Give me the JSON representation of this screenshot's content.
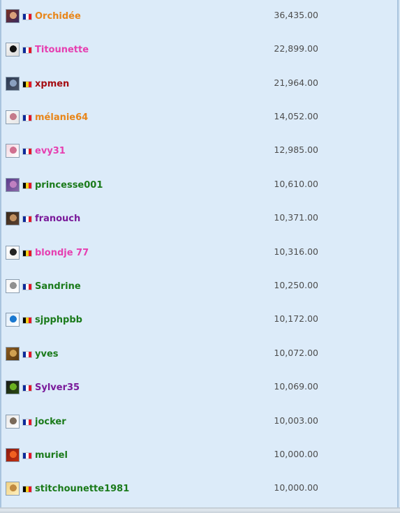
{
  "flag_colors": {
    "fr": [
      "#0d2a9a",
      "#ffffff",
      "#e3172a"
    ],
    "be": [
      "#000000",
      "#f5d21b",
      "#e3172a"
    ]
  },
  "leaderboard": [
    {
      "username": "Orchidée",
      "points": "36,435.00",
      "flag": "fr",
      "color": "#e8861a",
      "avatar_icon": "avatar-anime-girl-icon",
      "avatar_colors": [
        "#7a3020",
        "#d9a07a",
        "#3a2a60"
      ]
    },
    {
      "username": "Titounette",
      "points": "22,899.00",
      "flag": "fr",
      "color": "#e63fb0",
      "avatar_icon": "avatar-black-cat-icon",
      "avatar_colors": [
        "#f4f4f4",
        "#111111",
        "#dcdcdc"
      ]
    },
    {
      "username": "xpmen",
      "points": "21,964.00",
      "flag": "be",
      "color": "#a50d12",
      "avatar_icon": "avatar-landscape-icon",
      "avatar_colors": [
        "#2d3a52",
        "#8aa0bf",
        "#4a5568"
      ]
    },
    {
      "username": "mélanie64",
      "points": "14,052.00",
      "flag": "fr",
      "color": "#e8861a",
      "avatar_icon": "avatar-cartoon-icon",
      "avatar_colors": [
        "#fafafa",
        "#c47a8a",
        "#e6e6e6"
      ]
    },
    {
      "username": "evy31",
      "points": "12,985.00",
      "flag": "fr",
      "color": "#e63fb0",
      "avatar_icon": "avatar-pink-icon",
      "avatar_colors": [
        "#f3d6e0",
        "#d07090",
        "#ffffff"
      ]
    },
    {
      "username": "princesse001",
      "points": "10,610.00",
      "flag": "be",
      "color": "#1a7a1a",
      "avatar_icon": "avatar-princess-icon",
      "avatar_colors": [
        "#5a3a8a",
        "#c080c0",
        "#8a6aa8"
      ]
    },
    {
      "username": "franouch",
      "points": "10,371.00",
      "flag": "fr",
      "color": "#7a1a9a",
      "avatar_icon": "avatar-portrait-icon",
      "avatar_colors": [
        "#3a2a1a",
        "#c09060",
        "#5a4030"
      ]
    },
    {
      "username": "blondje 77",
      "points": "10,316.00",
      "flag": "be",
      "color": "#e63fb0",
      "avatar_icon": "avatar-cow-icon",
      "avatar_colors": [
        "#ffffff",
        "#222222",
        "#f0f0f0"
      ]
    },
    {
      "username": "Sandrine",
      "points": "10,250.00",
      "flag": "fr",
      "color": "#1a7a1a",
      "avatar_icon": "avatar-sketch-icon",
      "avatar_colors": [
        "#f5f5f5",
        "#909090",
        "#ffffff"
      ]
    },
    {
      "username": "sjpphpbb",
      "points": "10,172.00",
      "flag": "be",
      "color": "#1a7a1a",
      "avatar_icon": "avatar-smiley-icon",
      "avatar_colors": [
        "#dcebf9",
        "#1a78d0",
        "#ffffff"
      ]
    },
    {
      "username": "yves",
      "points": "10,072.00",
      "flag": "fr",
      "color": "#1a7a1a",
      "avatar_icon": "avatar-lion-icon",
      "avatar_colors": [
        "#8a5a20",
        "#d0a050",
        "#5a3a10"
      ]
    },
    {
      "username": "Sylver35",
      "points": "10,069.00",
      "flag": "fr",
      "color": "#7a1a9a",
      "avatar_icon": "avatar-alien-icon",
      "avatar_colors": [
        "#1a1a1a",
        "#6ab020",
        "#2a4a10"
      ]
    },
    {
      "username": "jocker",
      "points": "10,003.00",
      "flag": "fr",
      "color": "#1a7a1a",
      "avatar_icon": "avatar-joker-icon",
      "avatar_colors": [
        "#e8e8e8",
        "#7a6a5a",
        "#ffffff"
      ]
    },
    {
      "username": "muriel",
      "points": "10,000.00",
      "flag": "fr",
      "color": "#1a7a1a",
      "avatar_icon": "avatar-fire-icon",
      "avatar_colors": [
        "#8a1a10",
        "#f06020",
        "#c03010"
      ]
    },
    {
      "username": "stitchounette1981",
      "points": "10,000.00",
      "flag": "be",
      "color": "#1a7a1a",
      "avatar_icon": "avatar-blonde-icon",
      "avatar_colors": [
        "#f0d080",
        "#c08a40",
        "#fff0c0"
      ]
    }
  ]
}
